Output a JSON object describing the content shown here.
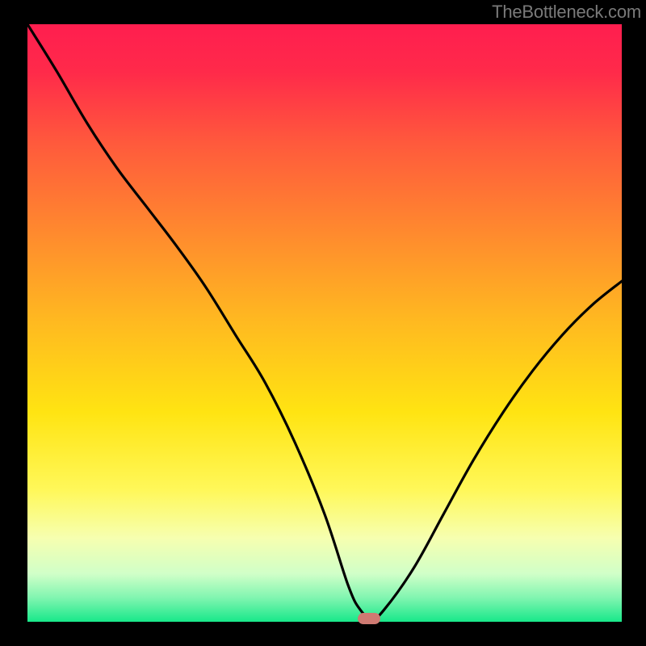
{
  "watermark": "TheBottleneck.com",
  "chart_data": {
    "type": "line",
    "title": "",
    "xlabel": "",
    "ylabel": "",
    "x": [
      0.0,
      0.05,
      0.1,
      0.15,
      0.2,
      0.25,
      0.3,
      0.35,
      0.4,
      0.45,
      0.5,
      0.54,
      0.56,
      0.58,
      0.6,
      0.65,
      0.7,
      0.75,
      0.8,
      0.85,
      0.9,
      0.95,
      1.0
    ],
    "values": [
      1.0,
      0.92,
      0.835,
      0.76,
      0.695,
      0.63,
      0.56,
      0.48,
      0.4,
      0.3,
      0.18,
      0.06,
      0.02,
      0.005,
      0.02,
      0.09,
      0.18,
      0.27,
      0.35,
      0.42,
      0.48,
      0.53,
      0.57
    ],
    "ylim": [
      0,
      1
    ],
    "xlim": [
      0,
      1
    ],
    "marker_x": 0.575,
    "marker_y": 0.005,
    "annotations": [],
    "gradient_stops": [
      {
        "pos": 0.0,
        "color": "#ff1e4f"
      },
      {
        "pos": 0.08,
        "color": "#ff2a4a"
      },
      {
        "pos": 0.2,
        "color": "#ff5a3c"
      },
      {
        "pos": 0.35,
        "color": "#ff8a2e"
      },
      {
        "pos": 0.5,
        "color": "#ffba20"
      },
      {
        "pos": 0.65,
        "color": "#ffe412"
      },
      {
        "pos": 0.78,
        "color": "#fff85a"
      },
      {
        "pos": 0.86,
        "color": "#f6ffb0"
      },
      {
        "pos": 0.92,
        "color": "#d0ffc8"
      },
      {
        "pos": 0.96,
        "color": "#80f5b0"
      },
      {
        "pos": 1.0,
        "color": "#18e88a"
      }
    ]
  }
}
